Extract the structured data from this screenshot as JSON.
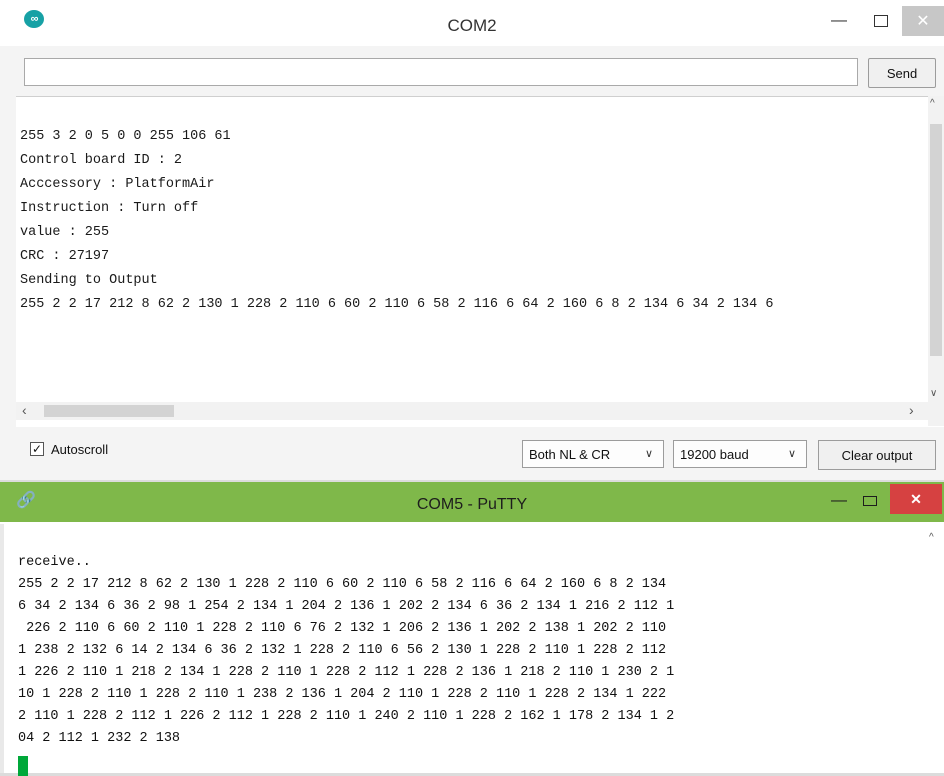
{
  "arduino": {
    "title": "COM2",
    "app_icon": "∞",
    "send_input_value": "",
    "send_label": "Send",
    "output_lines": [
      "255 3 2 0 5 0 0 255 106 61",
      "Control board ID : 2",
      "Acccessory : PlatformAir",
      "Instruction : Turn off",
      "value : 255",
      "CRC : 27197",
      "Sending to Output",
      "255 2 2 17 212 8 62 2 130 1 228 2 110 6 60 2 110 6 58 2 116 6 64 2 160 6 8 2 134 6 34 2 134 6"
    ],
    "autoscroll_label": "Autoscroll",
    "autoscroll_checked": true,
    "line_ending": "Both NL & CR",
    "baud_rate": "19200 baud",
    "clear_label": "Clear output",
    "icons": {
      "minimize": "minimize-icon",
      "maximize": "maximize-icon",
      "close": "close-icon",
      "dropdown": "chevron-down-icon"
    }
  },
  "putty": {
    "title": "COM5 - PuTTY",
    "terminal_lines": [
      "receive..",
      "255 2 2 17 212 8 62 2 130 1 228 2 110 6 60 2 110 6 58 2 116 6 64 2 160 6 8 2 134",
      "6 34 2 134 6 36 2 98 1 254 2 134 1 204 2 136 1 202 2 134 6 36 2 134 1 216 2 112 1",
      " 226 2 110 6 60 2 110 1 228 2 110 6 76 2 132 1 206 2 136 1 202 2 138 1 202 2 110",
      "1 238 2 132 6 14 2 134 6 36 2 132 1 228 2 110 6 56 2 130 1 228 2 110 1 228 2 112",
      "1 226 2 110 1 218 2 134 1 228 2 110 1 228 2 112 1 228 2 136 1 218 2 110 1 230 2 1",
      "10 1 228 2 110 1 228 2 110 1 238 2 136 1 204 2 110 1 228 2 110 1 228 2 134 1 222",
      "2 110 1 228 2 112 1 226 2 112 1 228 2 110 1 240 2 110 1 228 2 162 1 178 2 134 1 2",
      "04 2 112 1 232 2 138"
    ],
    "cursor_color": "#00a83a",
    "titlebar_color": "#7fb84a"
  }
}
